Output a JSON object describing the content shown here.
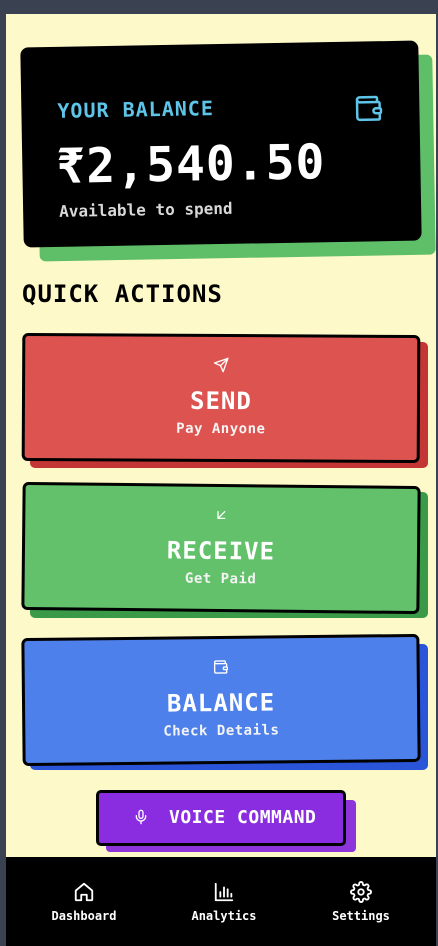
{
  "balance": {
    "label": "YOUR BALANCE",
    "amount": "₹2,540.50",
    "subtext": "Available to spend",
    "icon": "wallet-icon",
    "label_color": "#5ec4e8"
  },
  "quick_actions": {
    "title": "QUICK ACTIONS",
    "items": [
      {
        "title": "SEND",
        "subtitle": "Pay Anyone",
        "icon": "send-icon",
        "color": "#dd534f"
      },
      {
        "title": "RECEIVE",
        "subtitle": "Get Paid",
        "icon": "arrow-down-left-icon",
        "color": "#63c16b"
      },
      {
        "title": "BALANCE",
        "subtitle": "Check Details",
        "icon": "wallet-icon",
        "color": "#4d80ea"
      }
    ]
  },
  "voice_command": {
    "label": "VOICE COMMAND",
    "icon": "microphone-icon",
    "color": "#8a2cdf"
  },
  "bottom_nav": {
    "items": [
      {
        "label": "Dashboard",
        "icon": "home-icon"
      },
      {
        "label": "Analytics",
        "icon": "bar-chart-icon"
      },
      {
        "label": "Settings",
        "icon": "gear-icon"
      }
    ]
  }
}
